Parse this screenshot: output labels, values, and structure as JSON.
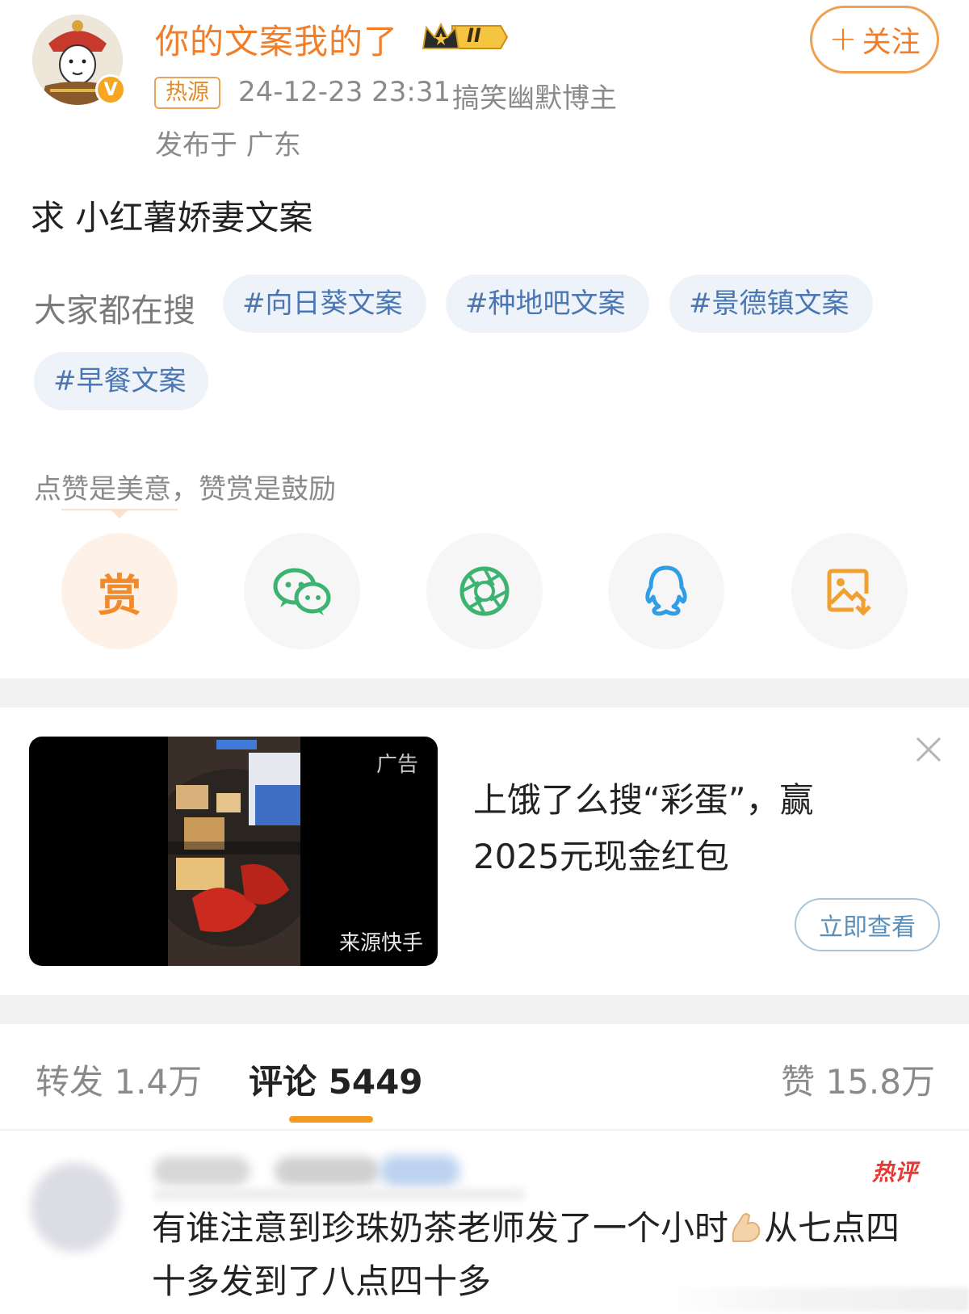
{
  "post": {
    "author": "你的文案我的了",
    "vip_level": "II",
    "hot_tag": "热源",
    "time": "24-12-23 23:31",
    "role": "搞笑幽默博主",
    "location": "发布于 广东",
    "follow_label": "关注",
    "text": "求 小红薯娇妻文案"
  },
  "search": {
    "label": "大家都在搜",
    "chips": [
      "#向日葵文案",
      "#种地吧文案",
      "#景德镇文案",
      "#早餐文案"
    ]
  },
  "reward": {
    "hint": "点赞是美意，赞赏是鼓励",
    "reward_char": "赏"
  },
  "share_icons": [
    "reward-icon",
    "wechat-icon",
    "moments-icon",
    "qq-icon",
    "save-image-icon"
  ],
  "ad": {
    "label": "广告",
    "source": "来源快手",
    "title": "上饿了么搜“彩蛋”，赢2025元现金红包",
    "button": "立即查看"
  },
  "tabs": {
    "repost": "转发 1.4万",
    "comment": "评论 5449",
    "like": "赞 15.8万"
  },
  "comment": {
    "hot_label": "热评",
    "text_part1": "有谁注意到珍珠奶茶老师发了一个小时",
    "text_part2": "从七点四十多发到了八点四十多"
  },
  "colors": {
    "accent": "#f07e2a",
    "link": "#4a76b3",
    "tab_indicator": "#f39a1f"
  }
}
